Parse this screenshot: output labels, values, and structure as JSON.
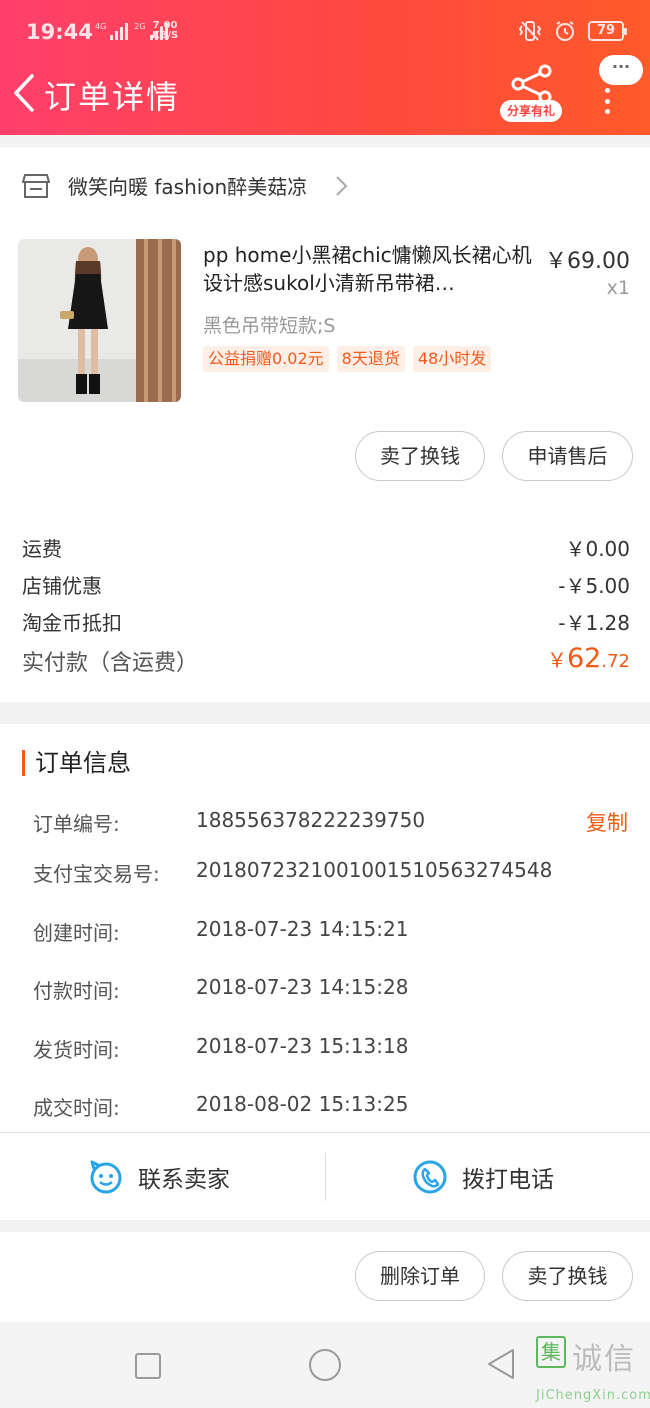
{
  "status_bar": {
    "time": "19:44",
    "net1": "4G",
    "net2": "2G",
    "speed_value": "7.00",
    "speed_unit": "KB/S",
    "battery": "79"
  },
  "header": {
    "title": "订单详情",
    "share_label": "分享有礼",
    "message_dots": "···"
  },
  "store": {
    "name": "微笑向暖 fashion醉美菇凉"
  },
  "product": {
    "title": "pp home小黑裙chic慵懒风长裙心机设计感sukol小清新吊带裙…",
    "price": "￥69.00",
    "quantity": "x1",
    "sku": "黑色吊带短款;S",
    "tags": [
      "公益捐赠0.02元",
      "8天退货",
      "48小时发"
    ]
  },
  "item_actions": {
    "sell_label": "卖了换钱",
    "after_sale_label": "申请售后"
  },
  "fees": [
    {
      "label": "运费",
      "value": "￥0.00"
    },
    {
      "label": "店铺优惠",
      "value": "-￥5.00"
    },
    {
      "label": "淘金币抵扣",
      "value": "-￥1.28"
    }
  ],
  "paid": {
    "label": "实付款（含运费）",
    "currency": "￥",
    "integer": "62",
    "decimal": ".72"
  },
  "order_info": {
    "title": "订单信息",
    "copy_label": "复制",
    "rows": [
      {
        "key": "订单编号:",
        "value": "188556378222239750"
      },
      {
        "key": "支付宝交易号:",
        "value": "2018072321001001510563274548"
      },
      {
        "key": "创建时间:",
        "value": "2018-07-23 14:15:21"
      },
      {
        "key": "付款时间:",
        "value": "2018-07-23 14:15:28"
      },
      {
        "key": "发货时间:",
        "value": "2018-07-23 15:13:18"
      },
      {
        "key": "成交时间:",
        "value": "2018-08-02 15:13:25"
      }
    ]
  },
  "contact": {
    "seller_label": "联系卖家",
    "phone_label": "拨打电话"
  },
  "footer_actions": {
    "delete_label": "删除订单",
    "sell_label": "卖了换钱"
  },
  "watermark": {
    "logo_char": "集",
    "text": "诚信",
    "url": "JiChengXin.com"
  },
  "colors": {
    "header_start": "#ff3f6b",
    "header_end": "#ff5a2a",
    "accent_orange": "#f05a14",
    "contact_blue": "#2aa4e8"
  }
}
